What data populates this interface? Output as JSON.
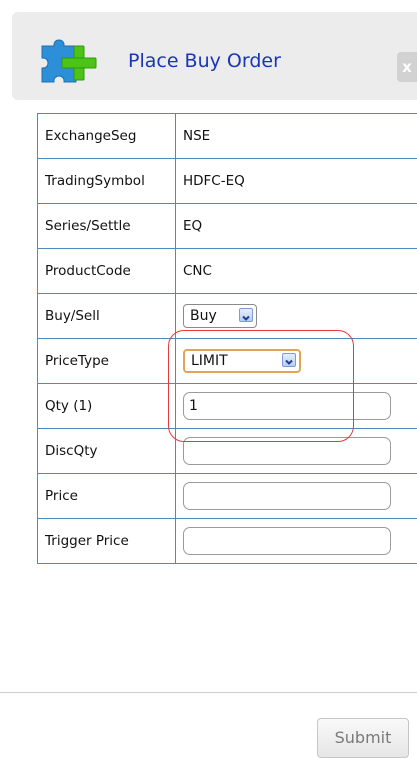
{
  "dialog": {
    "title": "Place Buy Order",
    "close_label": "x",
    "logo_icon": "puzzle-plus-icon",
    "close_icon": "close-icon"
  },
  "colors": {
    "title": "#1a35b8",
    "border": "#4d8ac2",
    "highlight": "#e23b3b",
    "focus": "#e0a55a"
  },
  "form": {
    "rows": [
      {
        "label": "ExchangeSeg",
        "value": "NSE"
      },
      {
        "label": "TradingSymbol",
        "value": "HDFC-EQ"
      },
      {
        "label": "Series/Settle",
        "value": "EQ"
      },
      {
        "label": "ProductCode",
        "value": "CNC"
      },
      {
        "label": "Buy/Sell",
        "selected": "Buy"
      },
      {
        "label": "PriceType",
        "selected": "LIMIT"
      },
      {
        "label": "Qty (1)",
        "input_value": "1"
      },
      {
        "label": "DiscQty",
        "input_value": ""
      },
      {
        "label": "Price",
        "input_value": ""
      },
      {
        "label": "Trigger Price",
        "input_value": ""
      }
    ]
  },
  "footer": {
    "submit_label": "Submit"
  }
}
